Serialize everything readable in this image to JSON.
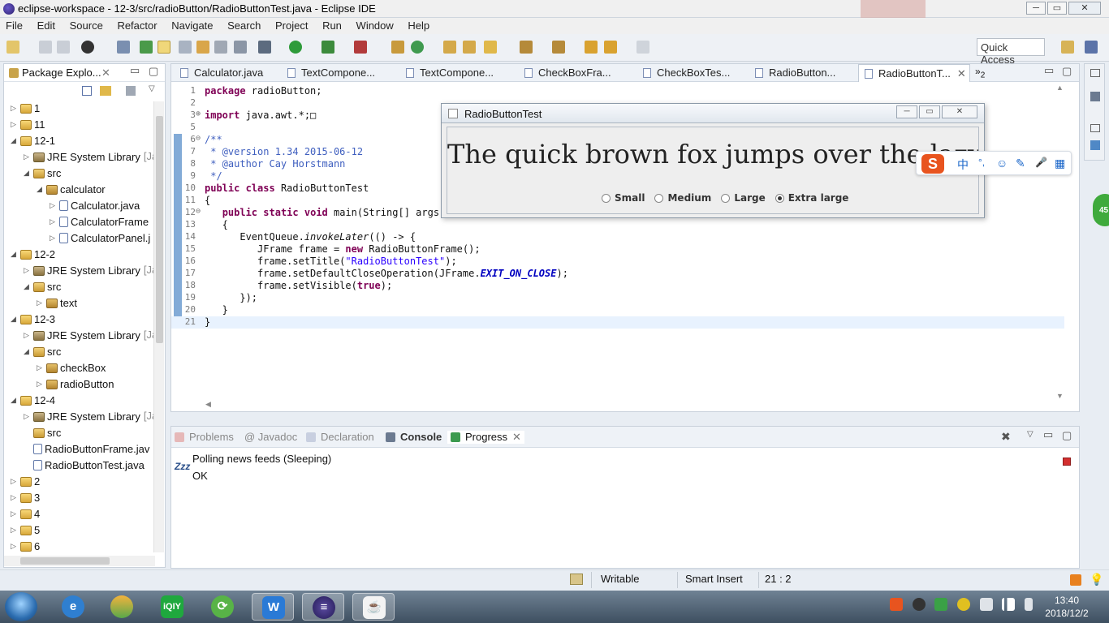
{
  "window": {
    "title": "eclipse-workspace - 12-3/src/radioButton/RadioButtonTest.java - Eclipse IDE",
    "controls": {
      "minimize": "─",
      "maximize": "▭",
      "close": "✕"
    }
  },
  "menu": [
    "File",
    "Edit",
    "Source",
    "Refactor",
    "Navigate",
    "Search",
    "Project",
    "Run",
    "Window",
    "Help"
  ],
  "toolbar": {
    "quick_access": "Quick Access"
  },
  "package_explorer": {
    "title": "Package Explo...",
    "items": [
      {
        "label": "1",
        "depth": 0,
        "icon": "proj",
        "twisty": "▷"
      },
      {
        "label": "11",
        "depth": 0,
        "icon": "proj",
        "twisty": "▷"
      },
      {
        "label": "12-1",
        "depth": 0,
        "icon": "proj",
        "twisty": "◢"
      },
      {
        "label": "JRE System Library",
        "suffix": "[Ja",
        "depth": 1,
        "icon": "lib",
        "twisty": "▷"
      },
      {
        "label": "src",
        "depth": 1,
        "icon": "src",
        "twisty": "◢"
      },
      {
        "label": "calculator",
        "depth": 2,
        "icon": "pkg",
        "twisty": "◢"
      },
      {
        "label": "Calculator.java",
        "depth": 3,
        "icon": "java",
        "twisty": "▷"
      },
      {
        "label": "CalculatorFrame",
        "depth": 3,
        "icon": "java",
        "twisty": "▷"
      },
      {
        "label": "CalculatorPanel.j",
        "depth": 3,
        "icon": "java",
        "twisty": "▷"
      },
      {
        "label": "12-2",
        "depth": 0,
        "icon": "proj",
        "twisty": "◢"
      },
      {
        "label": "JRE System Library",
        "suffix": "[Ja",
        "depth": 1,
        "icon": "lib",
        "twisty": "▷"
      },
      {
        "label": "src",
        "depth": 1,
        "icon": "src",
        "twisty": "◢"
      },
      {
        "label": "text",
        "depth": 2,
        "icon": "pkg",
        "twisty": "▷"
      },
      {
        "label": "12-3",
        "depth": 0,
        "icon": "proj",
        "twisty": "◢"
      },
      {
        "label": "JRE System Library",
        "suffix": "[Ja",
        "depth": 1,
        "icon": "lib",
        "twisty": "▷"
      },
      {
        "label": "src",
        "depth": 1,
        "icon": "src",
        "twisty": "◢"
      },
      {
        "label": "checkBox",
        "depth": 2,
        "icon": "pkg",
        "twisty": "▷"
      },
      {
        "label": "radioButton",
        "depth": 2,
        "icon": "pkg",
        "twisty": "▷"
      },
      {
        "label": "12-4",
        "depth": 0,
        "icon": "proj",
        "twisty": "◢"
      },
      {
        "label": "JRE System Library",
        "suffix": "[Ja",
        "depth": 1,
        "icon": "lib",
        "twisty": "▷"
      },
      {
        "label": "src",
        "depth": 1,
        "icon": "src",
        "twisty": ""
      },
      {
        "label": "RadioButtonFrame.jav",
        "depth": 1,
        "icon": "java",
        "twisty": ""
      },
      {
        "label": "RadioButtonTest.java",
        "depth": 1,
        "icon": "java",
        "twisty": ""
      },
      {
        "label": "2",
        "depth": 0,
        "icon": "proj",
        "twisty": "▷"
      },
      {
        "label": "3",
        "depth": 0,
        "icon": "proj",
        "twisty": "▷"
      },
      {
        "label": "4",
        "depth": 0,
        "icon": "proj",
        "twisty": "▷"
      },
      {
        "label": "5",
        "depth": 0,
        "icon": "proj",
        "twisty": "▷"
      },
      {
        "label": "6",
        "depth": 0,
        "icon": "proj",
        "twisty": "▷"
      }
    ]
  },
  "editor": {
    "tabs": [
      {
        "label": "Calculator.java",
        "active": false
      },
      {
        "label": "TextCompone...",
        "active": false
      },
      {
        "label": "TextCompone...",
        "active": false
      },
      {
        "label": "CheckBoxFra...",
        "active": false
      },
      {
        "label": "CheckBoxTes...",
        "active": false
      },
      {
        "label": "RadioButton...",
        "active": false
      },
      {
        "label": "RadioButtonT...",
        "active": true
      }
    ],
    "overflow_label": "»",
    "overflow_count": "2",
    "lines": [
      {
        "n": "1",
        "fold": "",
        "code": "package radioButton;"
      },
      {
        "n": "2",
        "fold": "",
        "code": ""
      },
      {
        "n": "3",
        "fold": "⊕",
        "code": "import java.awt.*;□"
      },
      {
        "n": "5",
        "fold": "",
        "code": ""
      },
      {
        "n": "6",
        "fold": "⊖",
        "code": "/**"
      },
      {
        "n": "7",
        "fold": "",
        "code": " * @version 1.34 2015-06-12"
      },
      {
        "n": "8",
        "fold": "",
        "code": " * @author Cay Horstmann"
      },
      {
        "n": "9",
        "fold": "",
        "code": " */"
      },
      {
        "n": "10",
        "fold": "",
        "code": "public class RadioButtonTest"
      },
      {
        "n": "11",
        "fold": "",
        "code": "{"
      },
      {
        "n": "12",
        "fold": "⊖",
        "code": "   public static void main(String[] args)"
      },
      {
        "n": "13",
        "fold": "",
        "code": "   {"
      },
      {
        "n": "14",
        "fold": "",
        "code": "      EventQueue.invokeLater(() -> {"
      },
      {
        "n": "15",
        "fold": "",
        "code": "         JFrame frame = new RadioButtonFrame();"
      },
      {
        "n": "16",
        "fold": "",
        "code": "         frame.setTitle(\"RadioButtonTest\");"
      },
      {
        "n": "17",
        "fold": "",
        "code": "         frame.setDefaultCloseOperation(JFrame.EXIT_ON_CLOSE);"
      },
      {
        "n": "18",
        "fold": "",
        "code": "         frame.setVisible(true);"
      },
      {
        "n": "19",
        "fold": "",
        "code": "      });"
      },
      {
        "n": "20",
        "fold": "",
        "code": "   }"
      },
      {
        "n": "21",
        "fold": "",
        "code": "}"
      }
    ]
  },
  "swing_window": {
    "title": "RadioButtonTest",
    "sample_text": "The quick brown fox jumps over the lazy d",
    "radios": [
      {
        "label": "Small",
        "selected": false
      },
      {
        "label": "Medium",
        "selected": false
      },
      {
        "label": "Large",
        "selected": false
      },
      {
        "label": "Extra large",
        "selected": true
      }
    ]
  },
  "ime_bar": {
    "logo": "S",
    "items": [
      "中",
      "°,",
      "☺",
      "✎",
      "🎤",
      "▦"
    ]
  },
  "bottom_panel": {
    "tabs": [
      {
        "label": "Problems",
        "active": false
      },
      {
        "label": "@ Javadoc",
        "active": false
      },
      {
        "label": "Declaration",
        "active": false
      },
      {
        "label": "Console",
        "active": false
      },
      {
        "label": "Progress",
        "active": true
      }
    ],
    "progress": {
      "zzz": "Zzz",
      "job": "Polling news feeds (Sleeping)",
      "status": "OK"
    }
  },
  "status_bar": {
    "writable": "Writable",
    "insert_mode": "Smart Insert",
    "position": "21 : 2"
  },
  "side_badge": "45",
  "taskbar": {
    "clock_time": "13:40",
    "clock_date": "2018/12/2",
    "apps": [
      "ie",
      "browser",
      "iqiyi",
      "refresh",
      "wps",
      "eclipse",
      "java"
    ]
  },
  "colors": {
    "keyword": "#7f0055",
    "comment": "#3f5fbf",
    "string": "#2a00ff",
    "accent": "#4f88c6"
  }
}
